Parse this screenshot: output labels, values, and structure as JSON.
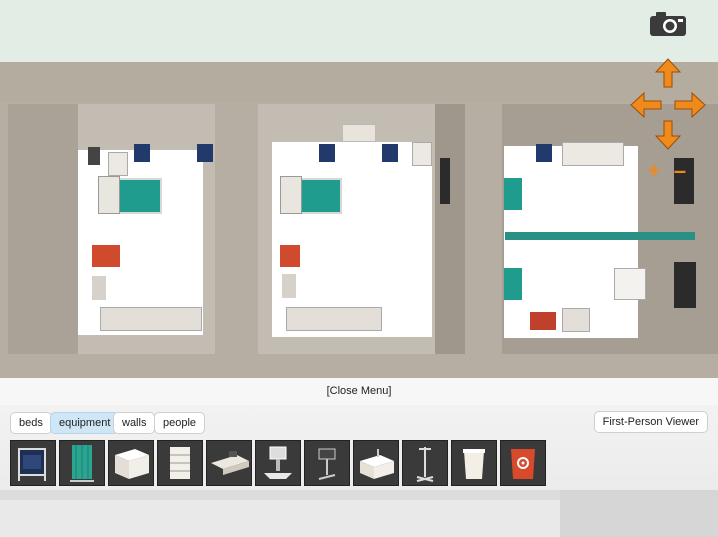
{
  "controls": {
    "camera_icon": "camera-icon",
    "arrows": [
      "arrow-up-icon",
      "arrow-left-icon",
      "arrow-right-icon",
      "arrow-down-icon"
    ],
    "zoom_in": "+",
    "zoom_out": "–",
    "accent_color": "#f08a1c"
  },
  "menu": {
    "close_label": "[Close Menu]"
  },
  "tabs": [
    {
      "label": "beds",
      "active": false
    },
    {
      "label": "equipment",
      "active": true
    },
    {
      "label": "walls",
      "active": false
    },
    {
      "label": "people",
      "active": false
    }
  ],
  "viewer_button": "First-Person Viewer",
  "palette": [
    {
      "name": "chair-item",
      "icon": "chair-icon"
    },
    {
      "name": "curtain-item",
      "icon": "curtain-icon"
    },
    {
      "name": "cabinet-item",
      "icon": "cabinet-icon"
    },
    {
      "name": "drawer-unit-item",
      "icon": "drawer-unit-icon"
    },
    {
      "name": "desk-item",
      "icon": "desk-icon"
    },
    {
      "name": "monitor-cart-item",
      "icon": "monitor-cart-icon"
    },
    {
      "name": "workstation-item",
      "icon": "workstation-icon"
    },
    {
      "name": "sink-item",
      "icon": "sink-icon"
    },
    {
      "name": "iv-pole-item",
      "icon": "iv-pole-icon"
    },
    {
      "name": "bin-item",
      "icon": "bin-icon"
    },
    {
      "name": "biohazard-bin-item",
      "icon": "biohazard-bin-icon"
    }
  ]
}
